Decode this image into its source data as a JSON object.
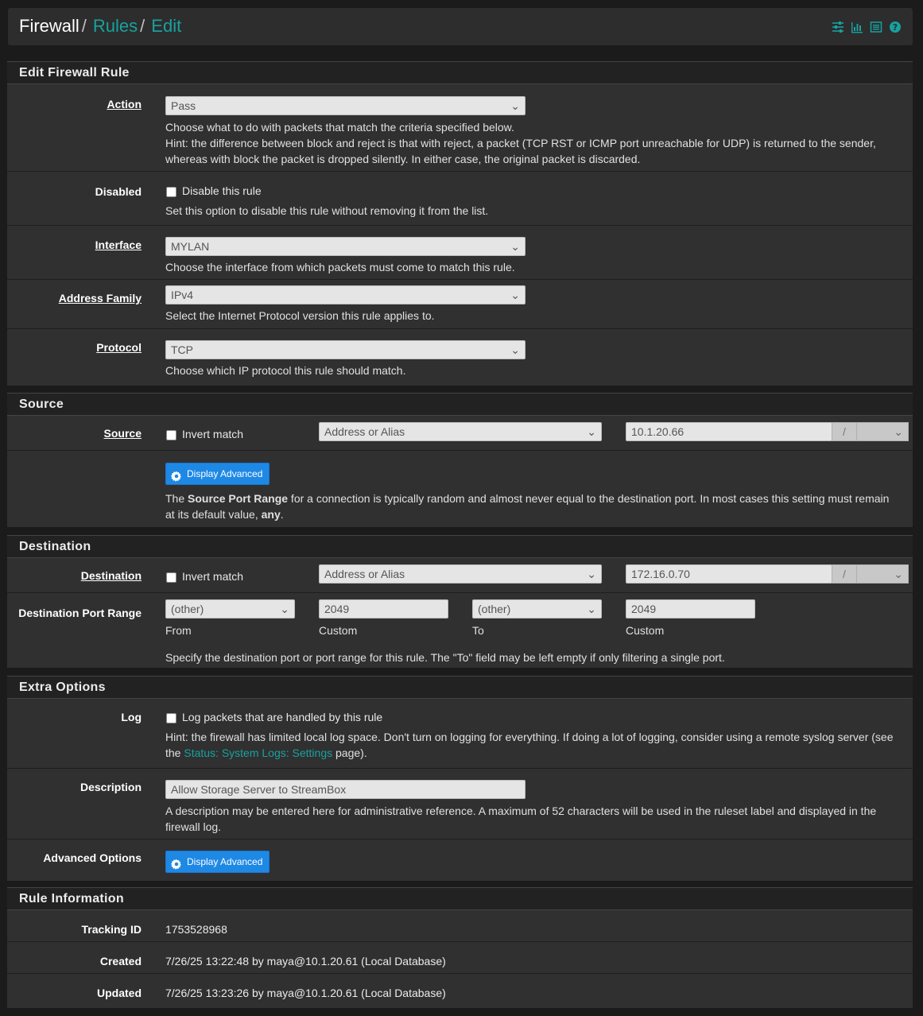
{
  "breadcrumb": {
    "root": "Firewall",
    "level2": "Rules",
    "level3": "Edit",
    "sep": "/"
  },
  "header_icons": [
    "sliders-icon",
    "bar-chart-icon",
    "list-icon",
    "help-icon"
  ],
  "edit_rule": {
    "title": "Edit Firewall Rule",
    "action": {
      "label": "Action",
      "value": "Pass",
      "help1": "Choose what to do with packets that match the criteria specified below.",
      "help2": "Hint: the difference between block and reject is that with reject, a packet (TCP RST or ICMP port unreachable for UDP) is returned to the sender, whereas with block the packet is dropped silently. In either case, the original packet is discarded."
    },
    "disabled": {
      "label": "Disabled",
      "checkbox_label": "Disable this rule",
      "checked": false,
      "help": "Set this option to disable this rule without removing it from the list."
    },
    "interface": {
      "label": "Interface",
      "value": "MYLAN",
      "help": "Choose the interface from which packets must come to match this rule."
    },
    "address_family": {
      "label": "Address Family",
      "value": "IPv4",
      "help": "Select the Internet Protocol version this rule applies to."
    },
    "protocol": {
      "label": "Protocol",
      "value": "TCP",
      "help": "Choose which IP protocol this rule should match."
    }
  },
  "source": {
    "title": "Source",
    "label": "Source",
    "invert_label": "Invert match",
    "invert_checked": false,
    "type": "Address or Alias",
    "address": "10.1.20.66",
    "mask_sep": "/",
    "mask": "",
    "advanced_button": "Display Advanced",
    "help_prefix": "The ",
    "help_bold": "Source Port Range",
    "help_mid": " for a connection is typically random and almost never equal to the destination port. In most cases this setting must remain at its default value, ",
    "help_bold2": "any",
    "help_suffix": "."
  },
  "destination": {
    "title": "Destination",
    "label": "Destination",
    "invert_label": "Invert match",
    "invert_checked": false,
    "type": "Address or Alias",
    "address": "172.16.0.70",
    "mask_sep": "/",
    "mask": "",
    "port_range": {
      "label": "Destination Port Range",
      "from_select": "(other)",
      "from_select_caption": "From",
      "from_custom": "2049",
      "from_custom_caption": "Custom",
      "to_select": "(other)",
      "to_select_caption": "To",
      "to_custom": "2049",
      "to_custom_caption": "Custom",
      "help": "Specify the destination port or port range for this rule. The \"To\" field may be left empty if only filtering a single port."
    }
  },
  "extra": {
    "title": "Extra Options",
    "log": {
      "label": "Log",
      "checkbox_label": "Log packets that are handled by this rule",
      "checked": false,
      "help_prefix": "Hint: the firewall has limited local log space. Don't turn on logging for everything. If doing a lot of logging, consider using a remote syslog server (see the ",
      "help_link": "Status: System Logs: Settings",
      "help_suffix": " page)."
    },
    "description": {
      "label": "Description",
      "value": "Allow Storage Server to StreamBox",
      "help": "A description may be entered here for administrative reference. A maximum of 52 characters will be used in the ruleset label and displayed in the firewall log."
    },
    "advanced": {
      "label": "Advanced Options",
      "button": "Display Advanced"
    }
  },
  "rule_info": {
    "title": "Rule Information",
    "tracking": {
      "label": "Tracking ID",
      "value": "1753528968"
    },
    "created": {
      "label": "Created",
      "value": "7/26/25 13:22:48 by maya@10.1.20.61 (Local Database)"
    },
    "updated": {
      "label": "Updated",
      "value": "7/26/25 13:23:26 by maya@10.1.20.61 (Local Database)"
    }
  },
  "colors": {
    "accent": "#17a2a0",
    "button": "#1e88e5",
    "panel": "#303030",
    "heading": "#222222"
  }
}
